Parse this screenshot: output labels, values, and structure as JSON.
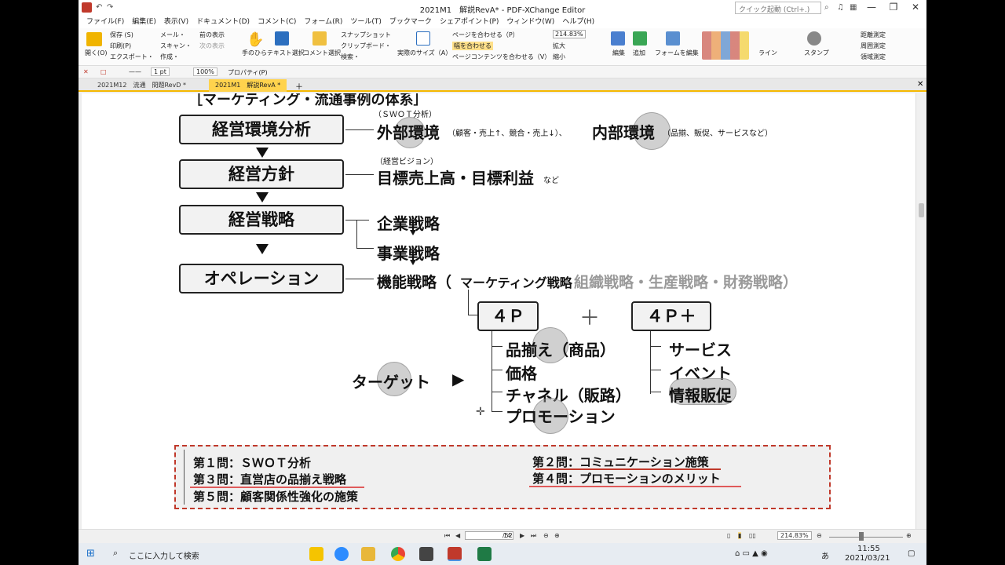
{
  "window": {
    "title": "2021M1　解説RevA* - PDF-XChange Editor",
    "search_placeholder": "クイック起動 (Ctrl+.)",
    "minimize": "—",
    "restore": "❐",
    "close": "✕"
  },
  "menu": [
    "ファイル(F)",
    "編集(E)",
    "表示(V)",
    "ドキュメント(D)",
    "コメント(C)",
    "フォーム(R)",
    "ツール(T)",
    "ブックマーク",
    "シェアポイント(P)",
    "ウィンドウ(W)",
    "ヘルプ(H)"
  ],
  "ribbon": {
    "open": "開く(O)",
    "save": "保存 (S)",
    "print": "印刷(P)",
    "export": "エクスポート・",
    "mail": "メール・",
    "scan": "スキャン・",
    "create": "作成・",
    "prev_view": "前の表示",
    "next_view": "次の表示",
    "hand": "手のひら",
    "text_select": "テキスト選択",
    "comment_select": "コメント選択",
    "snapshot": "スナップショット",
    "clipboard": "クリップボード・",
    "search": "検索・",
    "actual_size": "実際のサイズ（A）",
    "fit_page": "ページを合わせる（P）",
    "fit_width": "幅を合わせる",
    "fit_content": "ページコンテンツを合わせる（V）",
    "zoom": "214.83%",
    "zoom_in": "拡大",
    "zoom_out": "縮小",
    "edit": "編集",
    "add": "追加",
    "form_edit": "フォームを編集",
    "line": "ライン",
    "stamp": "スタンプ",
    "measure_distance": "距離測定",
    "measure_perimeter": "周囲測定",
    "measure_area": "領域測定"
  },
  "toolbar2": {
    "line_width": "1 pt",
    "zoom": "100%",
    "properties": "プロパティ(P)"
  },
  "tabs": [
    {
      "label": "2021M12　流通　問題RevD *",
      "active": false
    },
    {
      "label": "2021M1　解説RevA *",
      "active": true
    }
  ],
  "doc": {
    "heading": "［マーケティング・流通事例の体系］",
    "boxes": [
      "経営環境分析",
      "経営方針",
      "経営戦略",
      "オペレーション"
    ],
    "swot_note": "（ＳＷＯＴ分析）",
    "external": "外部環境",
    "external_note": "（顧客・売上↑、競合・売上↓）、",
    "internal": "内部環境",
    "internal_note": "（品揃、販促、サービスなど）",
    "vision_note": "（経営ビジョン）",
    "goals": "目標売上高・目標利益",
    "goals_suffix": "など",
    "corp_strategy": "企業戦略",
    "biz_strategy": "事業戦略",
    "func_strategy": "機能戦略（",
    "marketing_strategy": "マーケティング戦略",
    "other_strategies": "・組織戦略・生産戦略・財務戦略）",
    "fourp": "４Ｐ",
    "plus": "＋",
    "fourp_plus": "４Ｐ＋",
    "target": "ターゲット",
    "target_arrow": "▶",
    "fourp_items": [
      "品揃え（商品）",
      "価格",
      "チャネル（販路）",
      "プロモーション"
    ],
    "fourp_plus_items": [
      "サービス",
      "イベント",
      "情報販促"
    ],
    "questions": [
      "第１問：ＳＷＯＴ分析",
      "第２問：コミュニケーション施策",
      "第３問：直営店の品揃え戦略",
      "第４問：プロモーションのメリット",
      "第５問：顧客関係性強化の施策"
    ]
  },
  "status": {
    "page": "14",
    "total": "/52",
    "zoom": "214.83%"
  },
  "taskbar": {
    "search": "ここに入力して検索",
    "time": "11:55",
    "date": "2021/03/21",
    "ime": "あ"
  }
}
